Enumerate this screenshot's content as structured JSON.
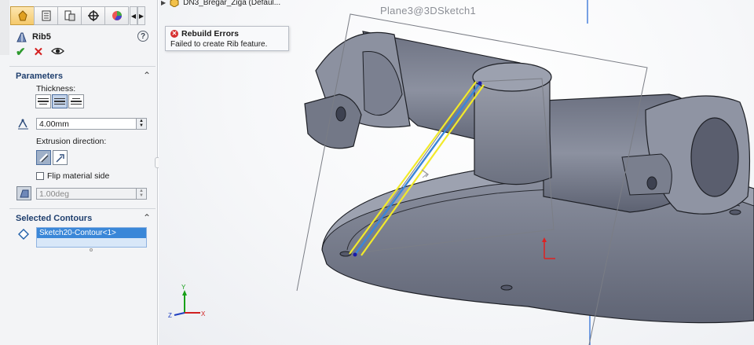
{
  "property_manager": {
    "tabs": [
      "feature-manager-icon",
      "property-manager-icon",
      "configuration-manager-icon",
      "dimxpert-icon",
      "display-manager-icon"
    ],
    "feature": {
      "name": "Rib5",
      "help": "?"
    },
    "actions": {
      "ok": "✔",
      "cancel": "✕",
      "preview": "eye"
    },
    "parameters": {
      "title": "Parameters",
      "thickness_label": "Thickness:",
      "thickness_value": "4.00mm",
      "extrusion_label": "Extrusion direction:",
      "flip_label": "Flip material side",
      "draft_value": "1.00deg"
    },
    "selected_contours": {
      "title": "Selected Contours",
      "items": [
        "Sketch20-Contour<1>"
      ]
    }
  },
  "viewport": {
    "tree_item": "DN3_Bregar_Ziga  (Defaul...",
    "plane_label": "Plane3@3DSketch1",
    "tooltip": {
      "title": "Rebuild Errors",
      "message": "Failed to create Rib feature."
    },
    "triad": {
      "y": "Y",
      "z": "Z",
      "x": "X"
    }
  },
  "colors": {
    "accent_blue": "#1f6fd0",
    "rib_yellow": "#f2ea2a",
    "part_gray": "#7f8491",
    "error_red": "#d63030"
  }
}
